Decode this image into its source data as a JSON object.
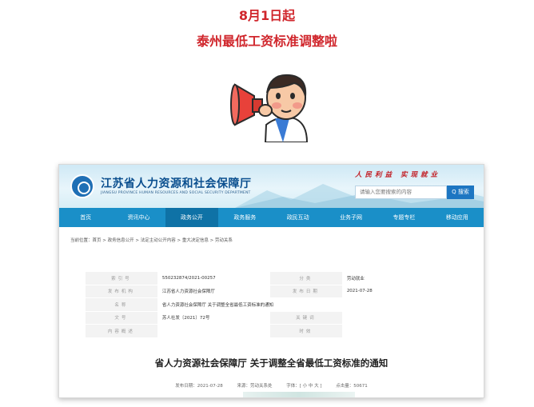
{
  "headline": {
    "line1": "8月1日起",
    "line2": "泰州最低工资标准调整啦"
  },
  "site": {
    "title": "江苏省人力资源和社会保障厅",
    "subtitle": "JIANGSU PROVINCE HUMAN RESOURCES AND SOCIAL SECURITY DEPARTMENT",
    "slogan": "人民利益    实现就业",
    "search_placeholder": "请输入您要搜索的内容",
    "search_button": "Q 搜索",
    "brand_color": "#1a8fc8"
  },
  "nav": {
    "items": [
      "首页",
      "资讯中心",
      "政务公开",
      "政务服务",
      "政民互动",
      "业务子网",
      "专题专栏",
      "移动应用"
    ],
    "active": "政务公开"
  },
  "breadcrumb": "当前位置：首页 > 政务信息公开 > 法定主动公开内容 > 重大决定信息 > 劳动关系",
  "meta": {
    "rows": [
      {
        "k1": "索引号",
        "v1": "550232874/2021-00257",
        "k2": "分类",
        "v2": "劳动就业"
      },
      {
        "k1": "发布机构",
        "v1": "江苏省人力资源社会保障厅",
        "k2": "发布日期",
        "v2": "2021-07-28"
      },
      {
        "k1": "名称",
        "v1": "省人力资源社会保障厅 关于调整全省最低工资标准的通知",
        "k2": "",
        "v2": ""
      },
      {
        "k1": "文号",
        "v1": "苏人社发〔2021〕72号",
        "k2": "关键词",
        "v2": ""
      },
      {
        "k1": "内容概述",
        "v1": "",
        "k2": "时效",
        "v2": ""
      }
    ]
  },
  "document": {
    "title": "省人力资源社会保障厅 关于调整全省最低工资标准的通知",
    "publish_date": "发布日期：2021-07-28",
    "source": "来源：劳动关系处",
    "font_size": "字体：[ 小 中 大 ]",
    "views": "点击量：50671"
  }
}
